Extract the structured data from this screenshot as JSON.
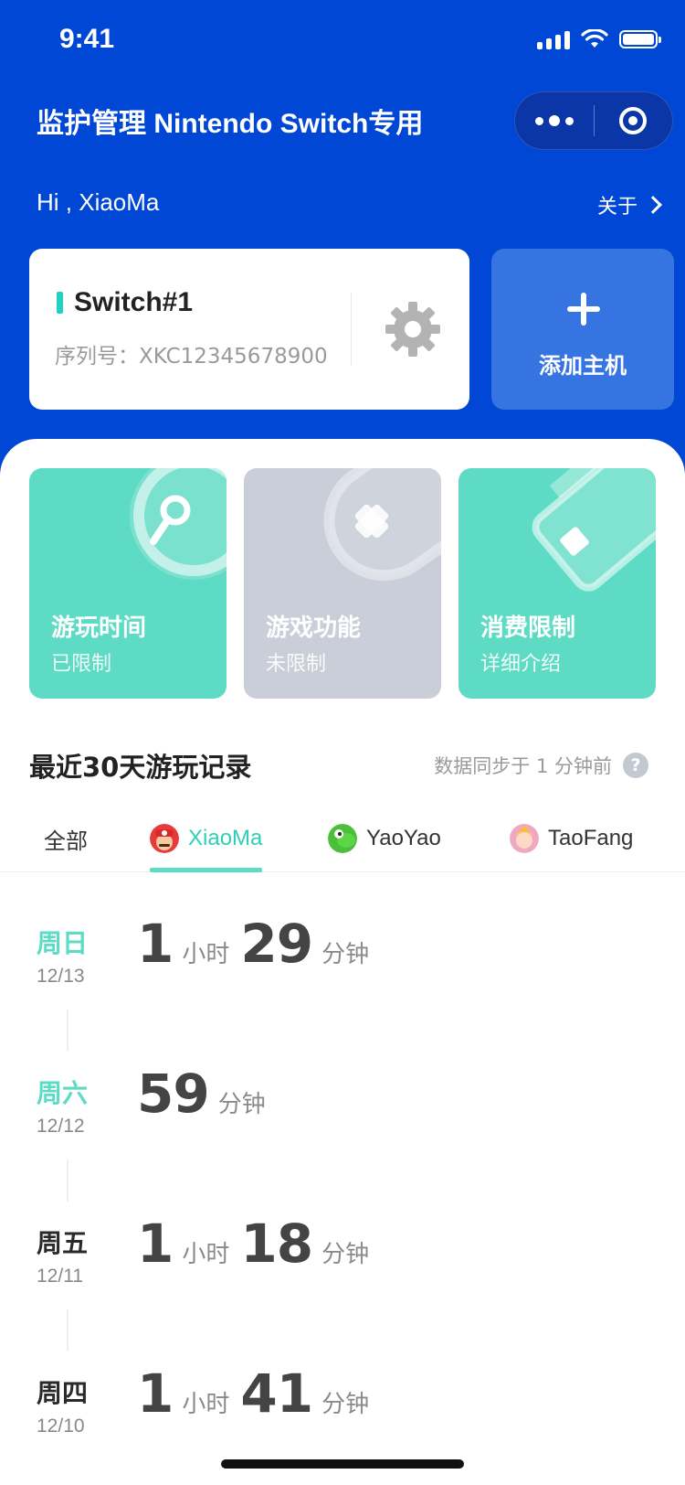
{
  "status_bar": {
    "time": "9:41"
  },
  "nav": {
    "title": "监护管理 Nintendo Switch专用"
  },
  "header": {
    "greeting": "Hi , XiaoMa",
    "about_label": "关于"
  },
  "device": {
    "name": "Switch#1",
    "serial": "序列号：XKC12345678900",
    "accent": "#1ed3c4"
  },
  "add_host": {
    "label": "添加主机"
  },
  "features": [
    {
      "title": "游玩时间",
      "subtitle": "已限制",
      "color": "#5ddbc4",
      "icon": "wrench-icon"
    },
    {
      "title": "游戏功能",
      "subtitle": "未限制",
      "color": "#c9ced8",
      "icon": "cross-icon"
    },
    {
      "title": "消费限制",
      "subtitle": "详细介绍",
      "color": "#5ddbc4",
      "icon": "card-icon"
    }
  ],
  "records_section": {
    "title": "最近30天游玩记录",
    "sync": "数据同步于 1 分钟前",
    "help_glyph": "?"
  },
  "tabs": [
    {
      "label": "全部"
    },
    {
      "label": "XiaoMa",
      "active": true
    },
    {
      "label": "YaoYao"
    },
    {
      "label": "TaoFang"
    }
  ],
  "records": [
    {
      "day": "周日",
      "date": "12/13",
      "hours": "1",
      "hour_unit": "小时",
      "minutes": "29",
      "minute_unit": "分钟",
      "highlight": true
    },
    {
      "day": "周六",
      "date": "12/12",
      "minutes": "59",
      "minute_unit": "分钟",
      "highlight": true
    },
    {
      "day": "周五",
      "date": "12/11",
      "hours": "1",
      "hour_unit": "小时",
      "minutes": "18",
      "minute_unit": "分钟",
      "highlight": false
    },
    {
      "day": "周四",
      "date": "12/10",
      "hours": "1",
      "hour_unit": "小时",
      "minutes": "41",
      "minute_unit": "分钟",
      "highlight": false
    }
  ],
  "colors": {
    "brand_blue": "#0047d6",
    "accent_green": "#5ddbc4",
    "add_card": "#3674e2"
  }
}
